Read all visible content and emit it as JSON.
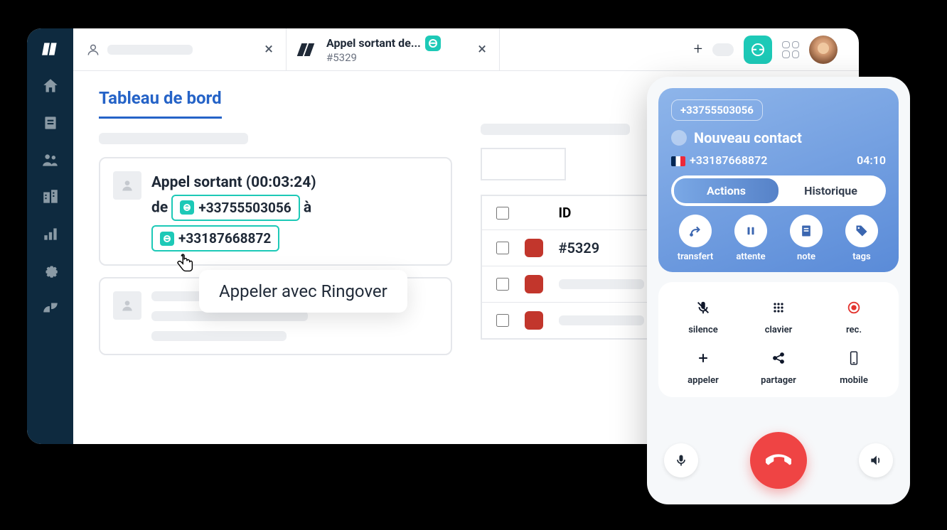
{
  "tabs": {
    "tab2_title": "Appel sortant de...",
    "tab2_sub": "#5329"
  },
  "page": {
    "title": "Tableau de bord"
  },
  "card": {
    "line1": "Appel sortant (00:03:24)",
    "line2_prefix": "de",
    "phone_from": "+33755503056",
    "line2_suffix": "à",
    "phone_to": "+33187668872"
  },
  "tooltip": "Appeler avec Ringover",
  "table": {
    "col_id": "ID",
    "rows": [
      "#5329",
      "",
      ""
    ]
  },
  "dialer": {
    "top_number": "+33755503056",
    "contact_name": "Nouveau contact",
    "contact_phone": "+33187668872",
    "timer": "04:10",
    "tabs": {
      "actions": "Actions",
      "history": "Historique"
    },
    "actions": {
      "transfer": "transfert",
      "hold": "attente",
      "note": "note",
      "tags": "tags"
    },
    "mid": {
      "silence": "silence",
      "keypad": "clavier",
      "rec": "rec.",
      "call": "appeler",
      "share": "partager",
      "mobile": "mobile"
    }
  }
}
